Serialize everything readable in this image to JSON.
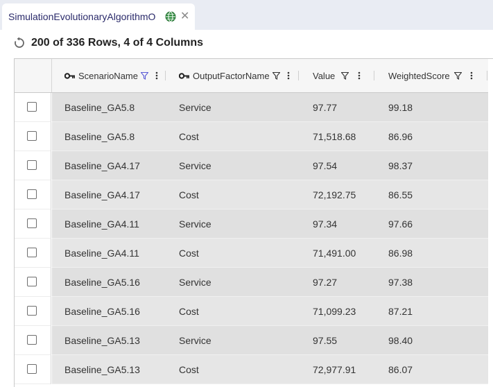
{
  "tab": {
    "title": "SimulationEvolutionaryAlgorithmO",
    "globe_icon": "globe-icon",
    "close_icon": "close-icon"
  },
  "toolbar": {
    "refresh_icon": "refresh-icon",
    "row_count": "200 of 336 Rows, 4 of 4 Columns"
  },
  "grid": {
    "columns": [
      {
        "label": "ScenarioName",
        "key": true,
        "filter_active": true
      },
      {
        "label": "OutputFactorName",
        "key": true,
        "filter_active": false
      },
      {
        "label": "Value",
        "key": false,
        "filter_active": false
      },
      {
        "label": "WeightedScore",
        "key": false,
        "filter_active": false
      }
    ],
    "rows": [
      [
        "Baseline_GA5.8",
        "Service",
        "97.77",
        "99.18"
      ],
      [
        "Baseline_GA5.8",
        "Cost",
        "71,518.68",
        "86.96"
      ],
      [
        "Baseline_GA4.17",
        "Service",
        "97.54",
        "98.37"
      ],
      [
        "Baseline_GA4.17",
        "Cost",
        "72,192.75",
        "86.55"
      ],
      [
        "Baseline_GA4.11",
        "Service",
        "97.34",
        "97.66"
      ],
      [
        "Baseline_GA4.11",
        "Cost",
        "71,491.00",
        "86.98"
      ],
      [
        "Baseline_GA5.16",
        "Service",
        "97.27",
        "97.38"
      ],
      [
        "Baseline_GA5.16",
        "Cost",
        "71,099.23",
        "87.21"
      ],
      [
        "Baseline_GA5.13",
        "Service",
        "97.55",
        "98.40"
      ],
      [
        "Baseline_GA5.13",
        "Cost",
        "72,977.91",
        "86.07"
      ]
    ]
  },
  "colors": {
    "active_filter": "#5b5bd6",
    "tab_bg": "#e9ecf3",
    "row_fill": "#e2e2e2"
  }
}
